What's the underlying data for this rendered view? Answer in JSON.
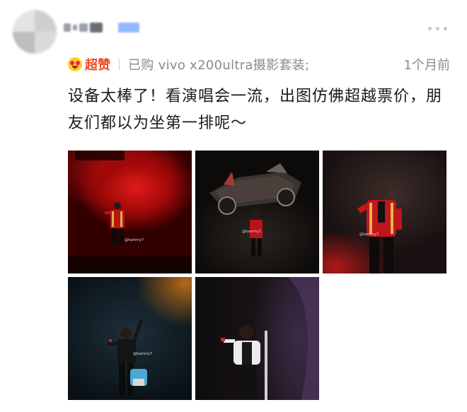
{
  "review": {
    "rating_label": "超赞",
    "purchase_info": "已购 vivo x200ultra摄影套装;",
    "time": "1个月前",
    "comment": "设备太棒了！看演唱会一流，出图仿佛超越票价，朋友们都以为坐第一排呢～"
  },
  "photos": [
    {
      "watermark": "@hammy7"
    },
    {
      "watermark": "@hammy7"
    },
    {
      "watermark": "@hammy7"
    },
    {
      "watermark": "@hammy7"
    },
    {
      "watermark": ""
    }
  ],
  "colors": {
    "accent": "#f04a22",
    "meta_text": "#8a8a8a",
    "body_text": "#1a1a1a"
  },
  "icons": {
    "rating": "heart-eyes-icon",
    "more": "more-icon"
  }
}
